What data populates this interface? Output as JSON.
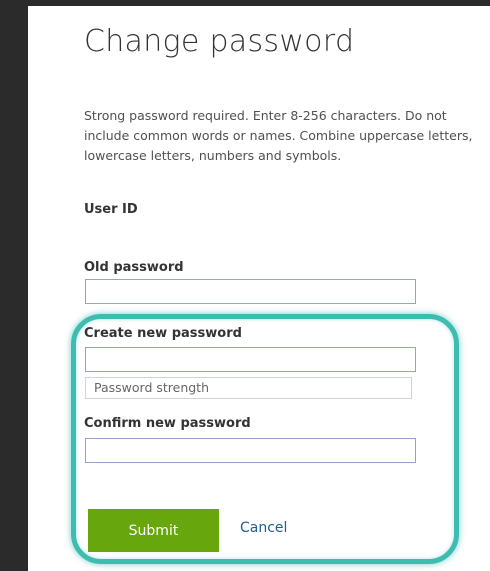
{
  "page": {
    "title": "Change password",
    "description": "Strong password required. Enter 8-256 characters. Do not include common words or names. Combine uppercase letters, lowercase letters, numbers and symbols."
  },
  "form": {
    "user_id_label": "User ID",
    "old_password_label": "Old password",
    "old_password_value": "",
    "new_password_label": "Create new password",
    "new_password_value": "",
    "password_strength_label": "Password strength",
    "confirm_password_label": "Confirm new password",
    "confirm_password_value": ""
  },
  "actions": {
    "submit_label": "Submit",
    "cancel_label": "Cancel"
  },
  "colors": {
    "background": "#2b2b2b",
    "panel": "#ffffff",
    "submit_button": "#68a60d",
    "cancel_link": "#1f5f8b",
    "field_border": "#8fa6c6",
    "highlight_ring": "#3ebcb0"
  }
}
